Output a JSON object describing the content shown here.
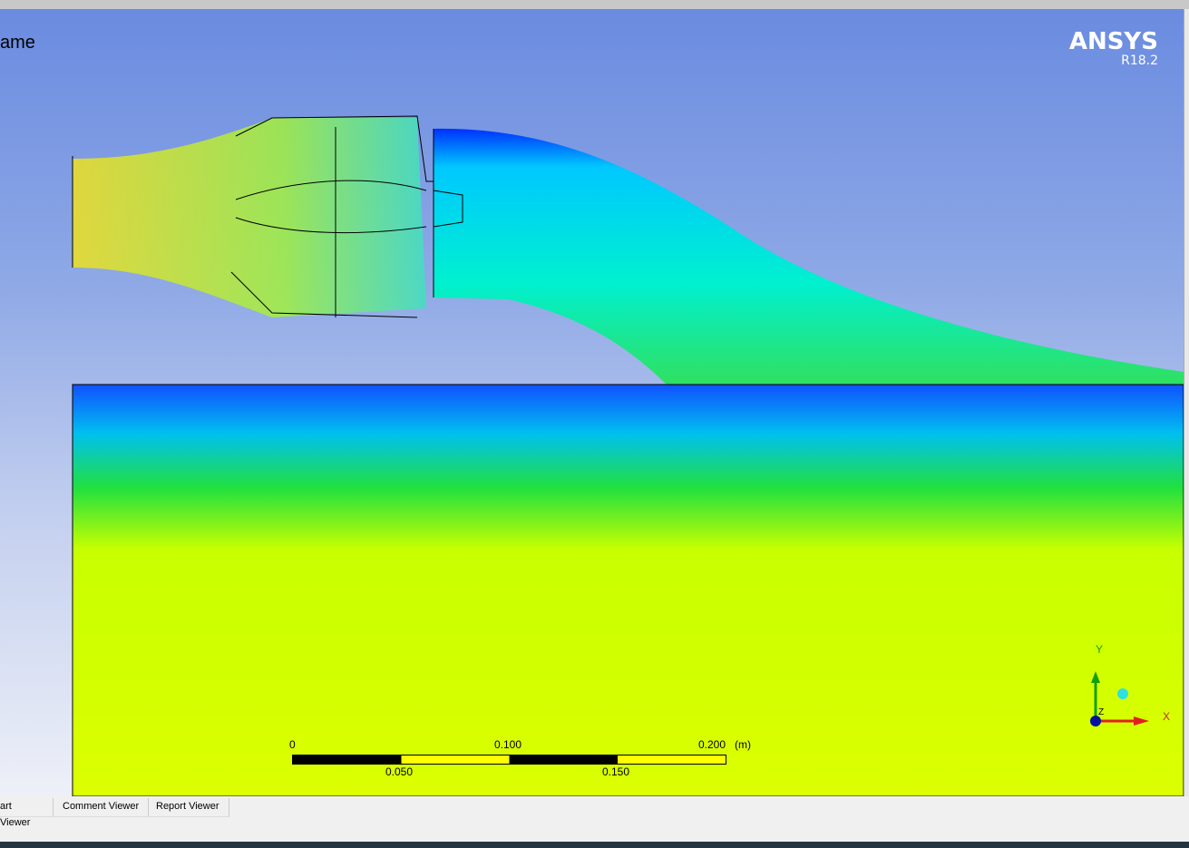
{
  "viewer": {
    "title": "ame",
    "logo": "ANSYS",
    "version": "R18.2"
  },
  "scale_bar": {
    "top_labels": [
      "0",
      "0.100",
      "0.200"
    ],
    "unit": "(m)",
    "bottom_labels": [
      "0.050",
      "0.150"
    ]
  },
  "triad": {
    "x": "X",
    "y": "Y",
    "z": "Z"
  },
  "tabs": [
    "art Viewer",
    "Comment Viewer",
    "Report Viewer"
  ],
  "colors": {
    "background_top": "#6a8be0",
    "field_yellow": "#d8ff00",
    "stream_cyan": "#00e8e8",
    "stream_blue": "#0040ff"
  }
}
